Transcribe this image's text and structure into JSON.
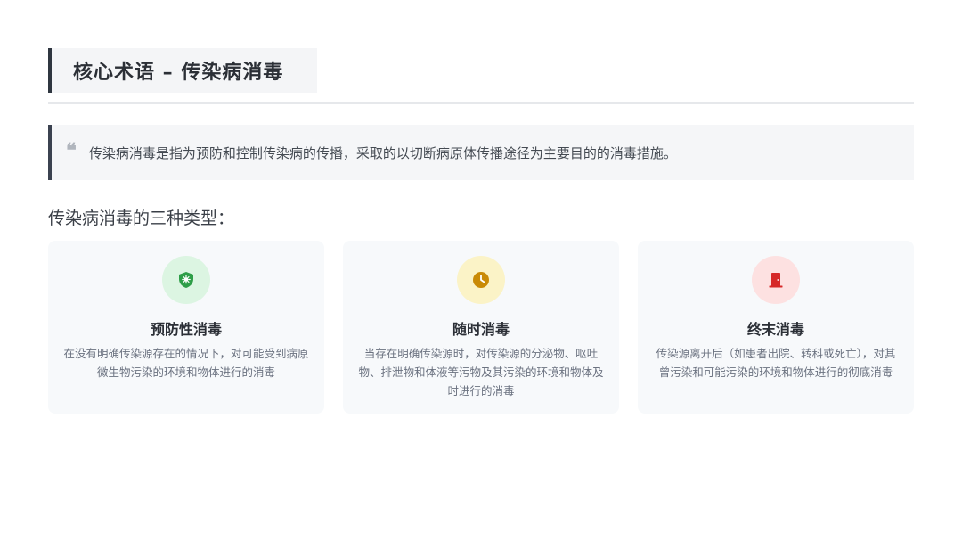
{
  "header": {
    "title": "核心术语 – 传染病消毒"
  },
  "definition": {
    "quote_mark": "❝",
    "text": "传染病消毒是指为预防和控制传染病的传播，采取的以切断病原体传播途径为主要目的的消毒措施。"
  },
  "section": {
    "heading": "传染病消毒的三种类型："
  },
  "cards": [
    {
      "icon": "shield-virus-icon",
      "icon_color": "#2e9e48",
      "icon_bg": "#dcf5e2",
      "title": "预防性消毒",
      "description": "在没有明确传染源存在的情况下，对可能受到病原微生物污染的环境和物体进行的消毒"
    },
    {
      "icon": "clock-icon",
      "icon_color": "#c98a06",
      "icon_bg": "#fbf3c7",
      "title": "随时消毒",
      "description": "当存在明确传染源时，对传染源的分泌物、呕吐物、排泄物和体液等污物及其污染的环境和物体及时进行的消毒"
    },
    {
      "icon": "door-icon",
      "icon_color": "#d62828",
      "icon_bg": "#fde1e1",
      "title": "终末消毒",
      "description": "传染源离开后（如患者出院、转科或死亡），对其曾污染和可能污染的环境和物体进行的彻底消毒"
    }
  ]
}
